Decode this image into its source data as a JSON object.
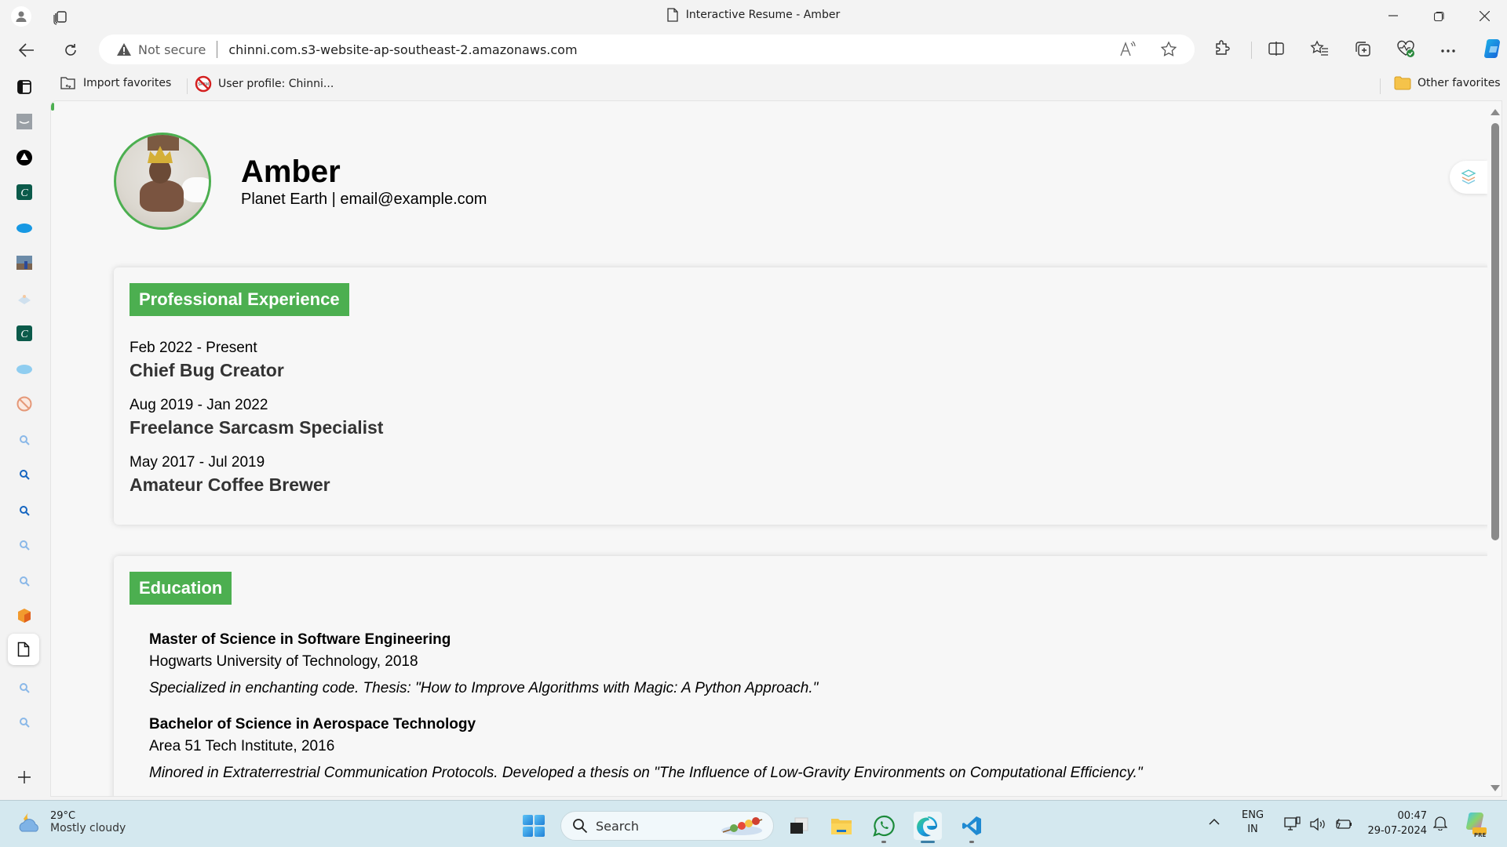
{
  "window": {
    "title": "Interactive Resume - Amber",
    "controls": [
      "minimize",
      "restore",
      "close"
    ]
  },
  "addressbar": {
    "security_label": "Not secure",
    "url": "chinni.com.s3-website-ap-southeast-2.amazonaws.com"
  },
  "toolbar": {
    "icons": [
      "read-aloud-icon",
      "favorite-star-icon",
      "extensions-icon",
      "split-screen-icon",
      "favorites-icon",
      "collections-icon",
      "browser-essentials-icon",
      "more-icon",
      "copilot-icon"
    ]
  },
  "favorites": {
    "items": [
      {
        "label": "Import favorites",
        "icon": "import-folder-icon"
      },
      {
        "label": "User profile: Chinni...",
        "icon": "no-spam-icon"
      }
    ],
    "other_label": "Other favorites"
  },
  "vertical_tabs": {
    "items": [
      {
        "icon": "tab-panel-icon"
      },
      {
        "icon": "amazon-tab-icon"
      },
      {
        "icon": "triangle-circle-tab-icon"
      },
      {
        "icon": "c-app-tab-icon"
      },
      {
        "icon": "salesforce-tab-icon"
      },
      {
        "icon": "photo-tab-icon"
      },
      {
        "icon": "faded-app-tab-icon"
      },
      {
        "icon": "c-app-tab-icon"
      },
      {
        "icon": "salesforce-tab-icon"
      },
      {
        "icon": "no-spam-tab-icon"
      },
      {
        "icon": "search-tab-icon"
      },
      {
        "icon": "search-tab-icon"
      },
      {
        "icon": "search-tab-icon"
      },
      {
        "icon": "search-tab-icon"
      },
      {
        "icon": "search-tab-icon"
      },
      {
        "icon": "box-tab-icon"
      },
      {
        "icon": "document-tab-icon",
        "active": true
      },
      {
        "icon": "search-tab-icon"
      },
      {
        "icon": "search-tab-icon"
      }
    ],
    "new_tab_icon": "plus-icon"
  },
  "resume": {
    "name": "Amber",
    "contact": "Planet Earth | email@example.com",
    "experience": {
      "title": "Professional Experience",
      "jobs": [
        {
          "dates": "Feb 2022 - Present",
          "title": "Chief Bug Creator"
        },
        {
          "dates": "Aug 2019 - Jan 2022",
          "title": "Freelance Sarcasm Specialist"
        },
        {
          "dates": "May 2017 - Jul 2019",
          "title": "Amateur Coffee Brewer"
        }
      ]
    },
    "education": {
      "title": "Education",
      "items": [
        {
          "degree": "Master of Science in Software Engineering",
          "school": "Hogwarts University of Technology, 2018",
          "description": "Specialized in enchanting code. Thesis: \"How to Improve Algorithms with Magic: A Python Approach.\""
        },
        {
          "degree": "Bachelor of Science in Aerospace Technology",
          "school": "Area 51 Tech Institute, 2016",
          "description": "Minored in Extraterrestrial Communication Protocols. Developed a thesis on \"The Influence of Low-Gravity Environments on Computational Efficiency.\""
        }
      ]
    }
  },
  "taskbar": {
    "weather": {
      "temp": "29°C",
      "condition": "Mostly cloudy"
    },
    "search_placeholder": "Search",
    "apps": [
      "task-view",
      "file-explorer",
      "whatsapp",
      "edge",
      "vscode"
    ],
    "language": {
      "line1": "ENG",
      "line2": "IN"
    },
    "clock": {
      "time": "00:47",
      "date": "29-07-2024"
    },
    "copilot_badge": "PRE"
  }
}
